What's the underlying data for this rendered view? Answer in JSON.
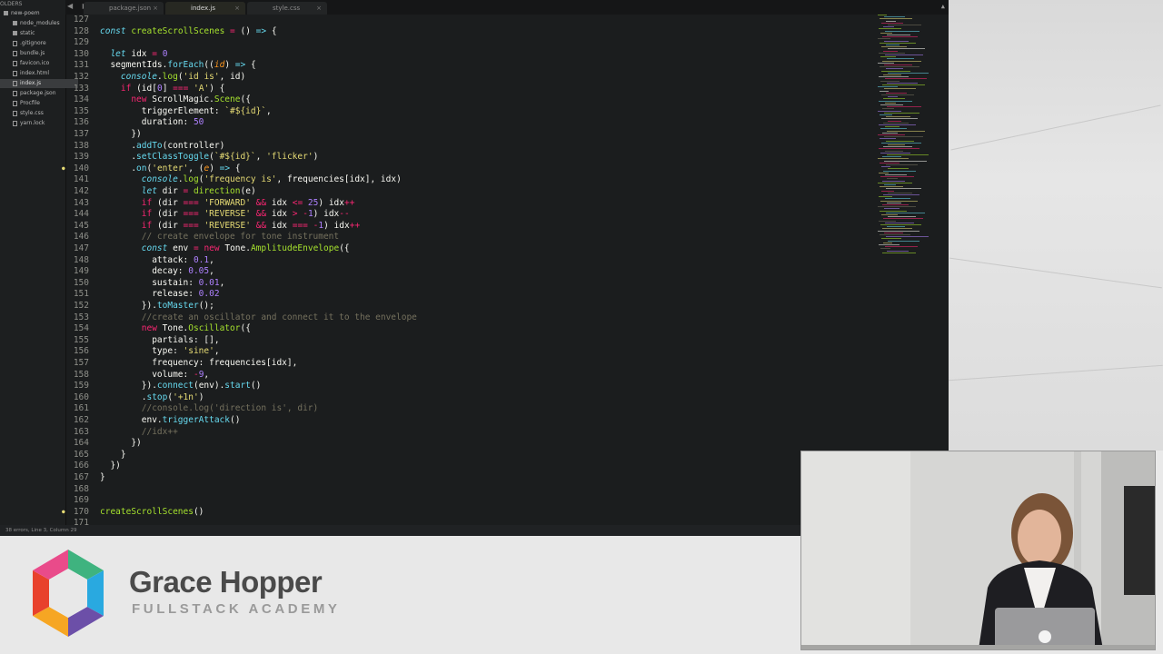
{
  "tabs": [
    {
      "label": "package.json",
      "active": false
    },
    {
      "label": "index.js",
      "active": true
    },
    {
      "label": "style.css",
      "active": false
    }
  ],
  "sidebar": {
    "header": "OLDERS",
    "items": [
      {
        "label": "new-poem",
        "type": "folder-open"
      },
      {
        "label": "node_modules",
        "type": "folder"
      },
      {
        "label": "static",
        "type": "folder"
      },
      {
        "label": ".gitignore",
        "type": "file"
      },
      {
        "label": "bundle.js",
        "type": "file"
      },
      {
        "label": "favicon.ico",
        "type": "file"
      },
      {
        "label": "index.html",
        "type": "file"
      },
      {
        "label": "index.js",
        "type": "file",
        "active": true
      },
      {
        "label": "package.json",
        "type": "file"
      },
      {
        "label": "Procfile",
        "type": "file"
      },
      {
        "label": "style.css",
        "type": "file"
      },
      {
        "label": "yarn.lock",
        "type": "file"
      }
    ]
  },
  "editor": {
    "line_numbers": [
      "127",
      "128",
      "129",
      "130",
      "131",
      "132",
      "133",
      "134",
      "135",
      "136",
      "137",
      "138",
      "139",
      "140",
      "141",
      "142",
      "143",
      "144",
      "145",
      "146",
      "147",
      "148",
      "149",
      "150",
      "151",
      "152",
      "153",
      "154",
      "155",
      "156",
      "157",
      "158",
      "159",
      "160",
      "161",
      "162",
      "163",
      "164",
      "165",
      "166",
      "167",
      "168",
      "169",
      "170",
      "171"
    ],
    "modified_lines": [
      "140",
      "170"
    ]
  },
  "status_bar": "38 errors, Line 3, Column 29",
  "banner": {
    "title": "Grace Hopper",
    "subtitle": "FULLSTACK ACADEMY"
  },
  "colors": {
    "editor_bg": "#1b1d1e",
    "keyword": "#f92672",
    "function": "#a6e22e",
    "string": "#e6db74",
    "number": "#ae81ff",
    "comment": "#75715e",
    "storage": "#66d9ef"
  }
}
